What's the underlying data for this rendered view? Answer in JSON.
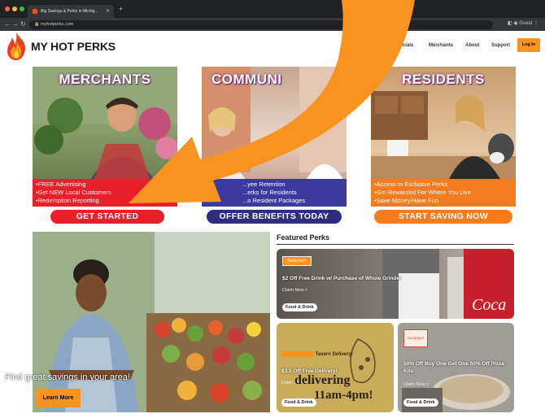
{
  "browser": {
    "tab_title": "Big Savings & Perks in Michig...",
    "url": "myhotperks.com",
    "profile": "Guest"
  },
  "header": {
    "brand": "MY HOT PERKS",
    "nav": [
      "Specials",
      "Merchants",
      "About",
      "Support"
    ],
    "login": "Log In"
  },
  "panels": [
    {
      "title": "MERCHANTS",
      "bullets": [
        "•FREE Advertising",
        "•Get NEW Local Customers",
        "•Redemption Reporting"
      ],
      "cta": "GET STARTED",
      "color": "#e8202a"
    },
    {
      "title": "COMMUNI",
      "bullets": [
        "...yee Retention",
        "...erks for Residents",
        "...o Resident Packages"
      ],
      "cta": "OFFER BENEFITS TODAY",
      "color": "#3b3a9e"
    },
    {
      "title": "RESIDENTS",
      "bullets": [
        "•Access to Exclusive Perks",
        "•Get Rewarded For Where You Live",
        "•Save Money/Have Fun"
      ],
      "cta": "START SAVING NOW",
      "color": "#f47b20"
    }
  ],
  "hero": {
    "text": "Find great savings in your area!",
    "button": "Learn More"
  },
  "featured": {
    "title": "Featured Perks",
    "cards": [
      {
        "title": "$2 Off Free Drink w/ Purchase of Whole Grinder",
        "claim": "Claim Now >",
        "tag": "Food & Drink",
        "logo": "Bellacino's"
      },
      {
        "title": "$3.5 Off Free Delivery!",
        "claim": "Claim Now >",
        "tag": "Food & Drink",
        "overlay": "delivering",
        "overlay2": "11am-4pm!",
        "banner": "Tavern Delivery!"
      },
      {
        "title": "50% Off Buy One Get One 50% Off Pizza Kits",
        "claim": "Claim Now >",
        "tag": "Food & Drink",
        "logo": "Sandpiper"
      }
    ]
  },
  "colors": {
    "accent": "#f7931e",
    "arrow": "#f7931e"
  }
}
